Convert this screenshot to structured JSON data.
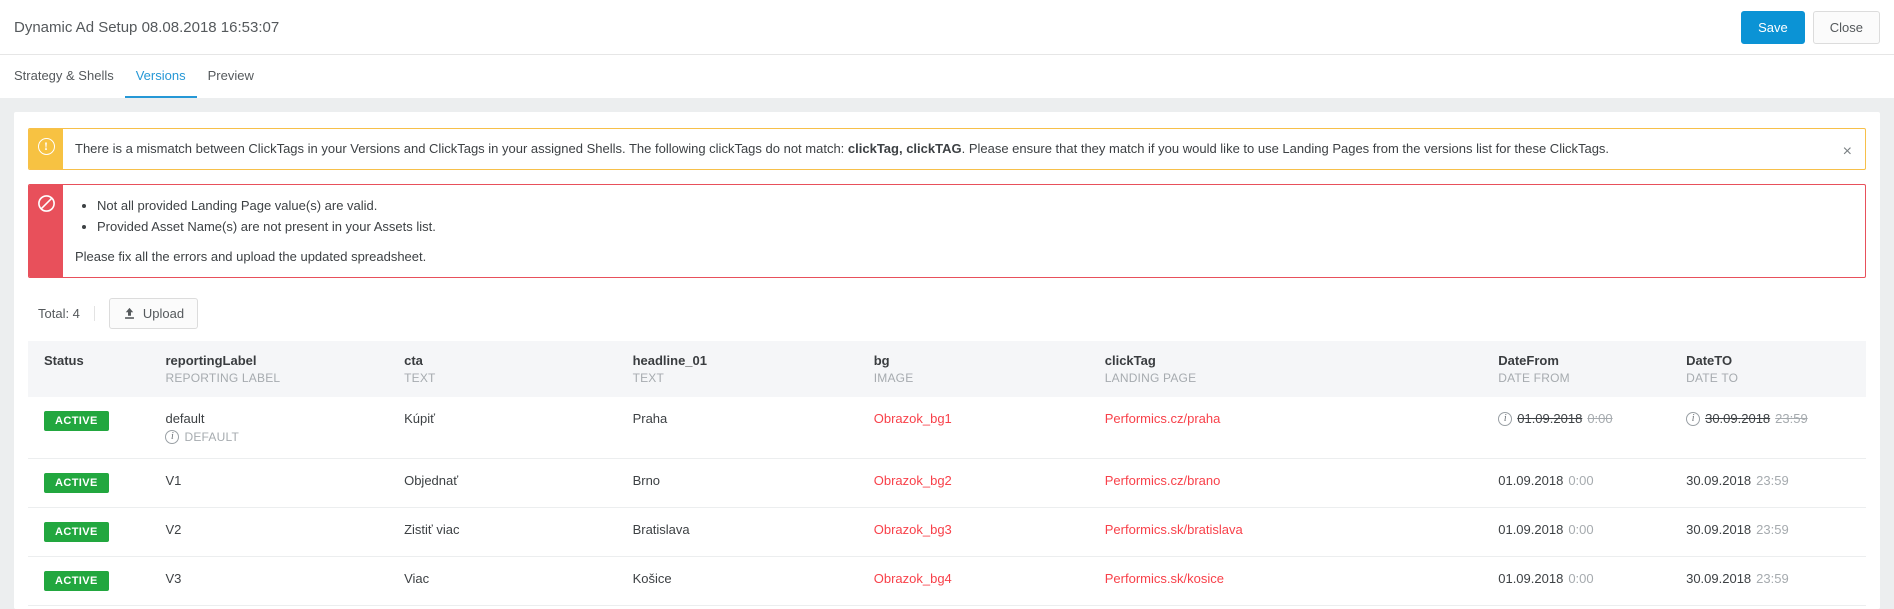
{
  "header": {
    "title": "Dynamic Ad Setup 08.08.2018 16:53:07",
    "save_label": "Save",
    "close_label": "Close"
  },
  "tabs": [
    {
      "label": "Strategy & Shells",
      "active": false
    },
    {
      "label": "Versions",
      "active": true
    },
    {
      "label": "Preview",
      "active": false
    }
  ],
  "alerts": {
    "warning": {
      "icon": "exclamation-circle-icon",
      "text_before": "There is a mismatch between ClickTags in your Versions and ClickTags in your assigned Shells. The following clickTags do not match: ",
      "text_bold": "clickTag, clickTAG",
      "text_after": ". Please ensure that they match if you would like to use Landing Pages from the versions list for these ClickTags.",
      "close_label": "×"
    },
    "error": {
      "icon": "prohibition-icon",
      "items": [
        "Not all provided Landing Page value(s) are valid.",
        "Provided Asset Name(s) are not present in your Assets list."
      ],
      "footer": "Please fix all the errors and upload the updated spreadsheet."
    }
  },
  "toolbar": {
    "total_label": "Total: 4",
    "upload_label": "Upload",
    "upload_icon": "upload-arrow-icon"
  },
  "table": {
    "columns": [
      {
        "name": "Status",
        "sub": ""
      },
      {
        "name": "reportingLabel",
        "sub": "REPORTING LABEL"
      },
      {
        "name": "cta",
        "sub": "TEXT"
      },
      {
        "name": "headline_01",
        "sub": "TEXT"
      },
      {
        "name": "bg",
        "sub": "IMAGE"
      },
      {
        "name": "clickTag",
        "sub": "LANDING PAGE"
      },
      {
        "name": "DateFrom",
        "sub": "DATE FROM"
      },
      {
        "name": "DateTO",
        "sub": "DATE TO"
      }
    ],
    "rows": [
      {
        "status": "ACTIVE",
        "reportingLabel": "default",
        "default_tag": "DEFAULT",
        "cta": "Kúpiť",
        "headline_01": "Praha",
        "bg": "Obrazok_bg1",
        "clickTag": "Performics.cz/praha",
        "date_from": "01.09.2018",
        "time_from": "0:00",
        "date_to": "30.09.2018",
        "time_to": "23:59",
        "dates_struck": true,
        "dates_info_icon": true
      },
      {
        "status": "ACTIVE",
        "reportingLabel": "V1",
        "default_tag": "",
        "cta": "Objednať",
        "headline_01": "Brno",
        "bg": "Obrazok_bg2",
        "clickTag": "Performics.cz/brano",
        "date_from": "01.09.2018",
        "time_from": "0:00",
        "date_to": "30.09.2018",
        "time_to": "23:59",
        "dates_struck": false,
        "dates_info_icon": false
      },
      {
        "status": "ACTIVE",
        "reportingLabel": "V2",
        "default_tag": "",
        "cta": "Zistiť viac",
        "headline_01": "Bratislava",
        "bg": "Obrazok_bg3",
        "clickTag": "Performics.sk/bratislava",
        "date_from": "01.09.2018",
        "time_from": "0:00",
        "date_to": "30.09.2018",
        "time_to": "23:59",
        "dates_struck": false,
        "dates_info_icon": false
      },
      {
        "status": "ACTIVE",
        "reportingLabel": "V3",
        "default_tag": "",
        "cta": "Viac",
        "headline_01": "Košice",
        "bg": "Obrazok_bg4",
        "clickTag": "Performics.sk/kosice",
        "date_from": "01.09.2018",
        "time_from": "0:00",
        "date_to": "30.09.2018",
        "time_to": "23:59",
        "dates_struck": false,
        "dates_info_icon": false
      }
    ]
  },
  "colors": {
    "primary": "#0b93d5",
    "tab_active": "#2698d6",
    "warning": "#f7c242",
    "danger": "#e8505b",
    "link_error": "#f8414a",
    "badge_active": "#22a73f"
  }
}
